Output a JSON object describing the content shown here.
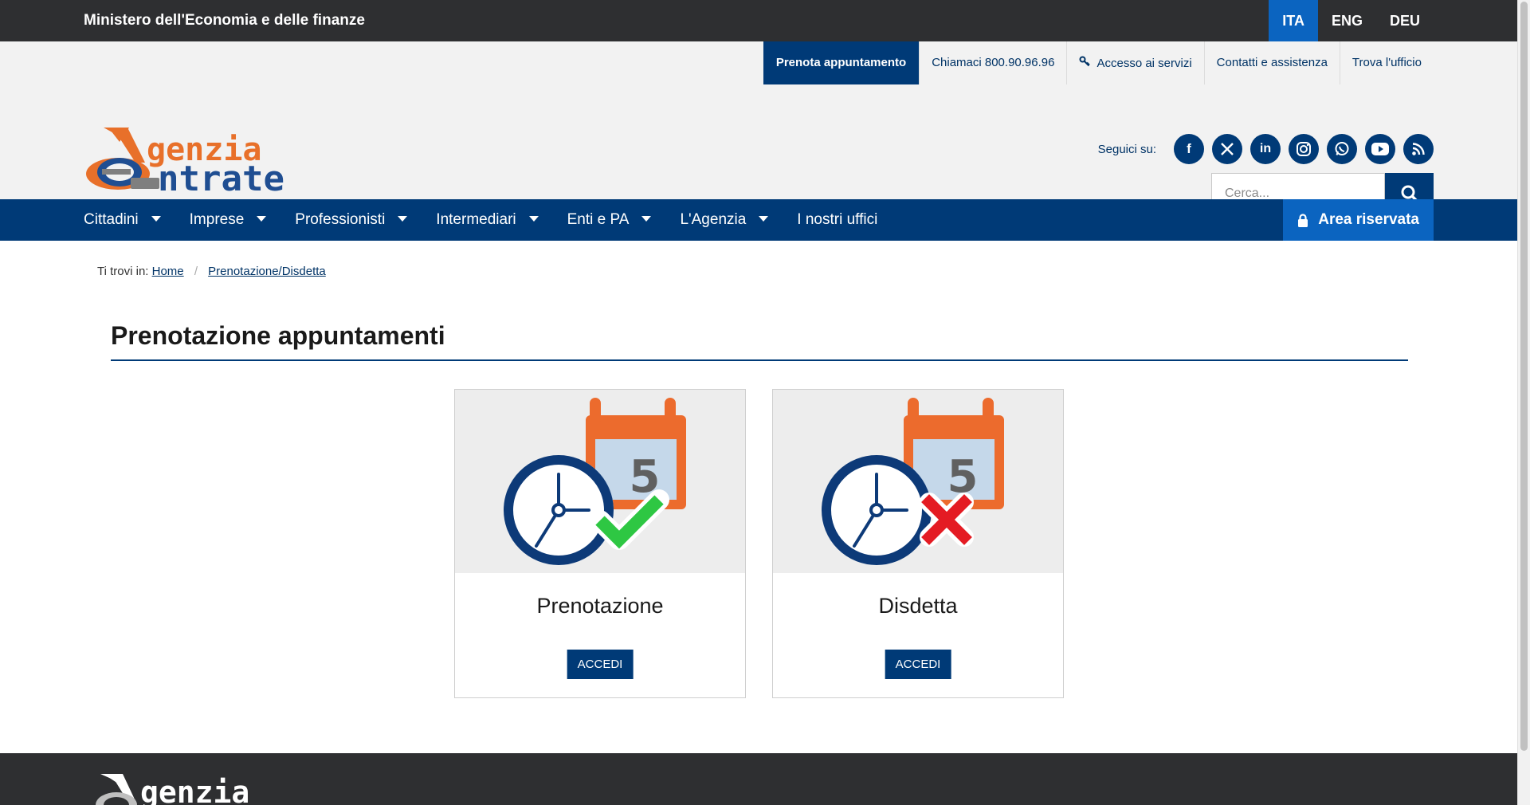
{
  "topbar": {
    "ministry": "Ministero dell'Economia e delle finanze",
    "languages": [
      "ITA",
      "ENG",
      "DEU"
    ],
    "active_language": "ITA"
  },
  "header": {
    "utility": {
      "book": "Prenota appuntamento",
      "call": "Chiamaci 800.90.96.96",
      "services": "Accesso ai servizi",
      "contacts": "Contatti e assistenza",
      "office": "Trova l'ufficio"
    },
    "logo": {
      "line1": "genzia",
      "line2": "ntrate"
    },
    "social": {
      "label": "Seguici su:",
      "icons": [
        "facebook-icon",
        "x-icon",
        "linkedin-icon",
        "instagram-icon",
        "whatsapp-icon",
        "youtube-icon",
        "rss-icon"
      ]
    },
    "search": {
      "placeholder": "Cerca..."
    }
  },
  "nav": {
    "items": [
      "Cittadini",
      "Imprese",
      "Professionisti",
      "Intermediari",
      "Enti e PA",
      "L'Agenzia",
      "I nostri uffici"
    ],
    "reserved": "Area riservata"
  },
  "breadcrumb": {
    "prefix": "Ti trovi in:",
    "home": "Home",
    "current": "Prenotazione/Disdetta"
  },
  "main": {
    "title": "Prenotazione appuntamenti",
    "cards": [
      {
        "title": "Prenotazione",
        "button": "ACCEDI",
        "calendar_day": "5",
        "mark": "check"
      },
      {
        "title": "Disdetta",
        "button": "ACCEDI",
        "calendar_day": "5",
        "mark": "cross"
      }
    ]
  },
  "footer": {
    "logo_text": "genzia"
  },
  "colors": {
    "brand_blue": "#003a77",
    "accent_blue": "#0b64c0",
    "dark_bar": "#2e2f31",
    "logo_orange": "#e8702a",
    "calendar_orange": "#ec6b2d",
    "check_green": "#2ec743",
    "cross_red": "#e41b23"
  }
}
